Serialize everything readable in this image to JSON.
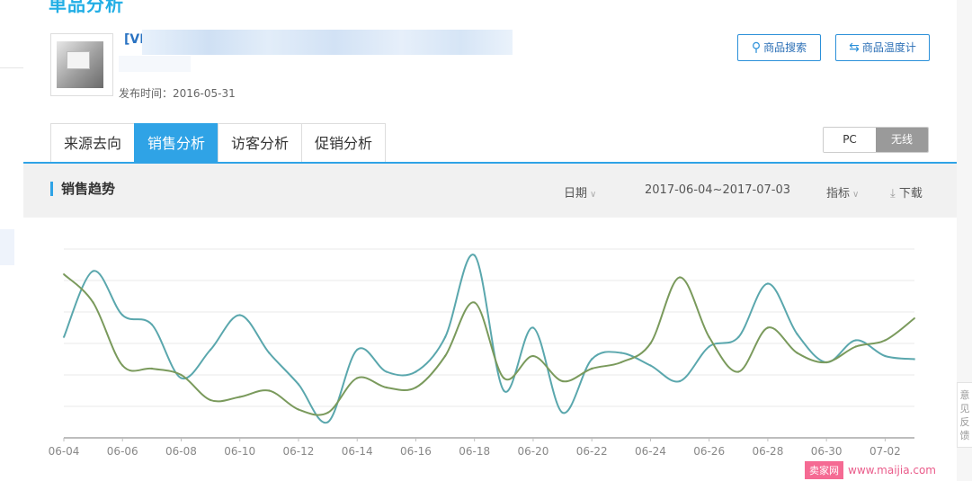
{
  "page": {
    "title": "单品分析"
  },
  "product": {
    "name_visible": "[VH/",
    "publish_date": "发布时间：2016-05-31"
  },
  "header_buttons": {
    "search_label": "商品搜索",
    "temp_label": "商品温度计"
  },
  "tabs": [
    {
      "label": "来源去向",
      "active": false
    },
    {
      "label": "销售分析",
      "active": true
    },
    {
      "label": "访客分析",
      "active": false
    },
    {
      "label": "促销分析",
      "active": false
    }
  ],
  "device_toggle": {
    "pc_label": "PC",
    "wireless_label": "无线",
    "selected": "无线"
  },
  "section": {
    "title": "销售趋势",
    "date_filter_label": "日期",
    "date_range": "2017-06-04~2017-07-03",
    "metric_filter_label": "指标",
    "download_label": "下载"
  },
  "side_float": {
    "text": "意见反馈"
  },
  "watermark": {
    "badge": "卖家网",
    "url": "www.maijia.com"
  },
  "colors": {
    "accent": "#2fa3e6",
    "teal_series": "#5aa7ad",
    "olive_series": "#7a9a5c"
  },
  "chart_data": {
    "type": "line",
    "x": [
      "06-04",
      "06-05",
      "06-06",
      "06-07",
      "06-08",
      "06-09",
      "06-10",
      "06-11",
      "06-12",
      "06-13",
      "06-14",
      "06-15",
      "06-16",
      "06-17",
      "06-18",
      "06-19",
      "06-20",
      "06-21",
      "06-22",
      "06-23",
      "06-24",
      "06-25",
      "06-26",
      "06-27",
      "06-28",
      "06-29",
      "06-30",
      "07-01",
      "07-02",
      "07-03"
    ],
    "tick_labels": [
      "06-04",
      "06-06",
      "06-08",
      "06-10",
      "06-12",
      "06-14",
      "06-16",
      "06-18",
      "06-20",
      "06-22",
      "06-24",
      "06-26",
      "06-28",
      "06-30",
      "07-02"
    ],
    "y_axis_labels_visible": false,
    "ylim": [
      0,
      6
    ],
    "grid": true,
    "series": [
      {
        "color": "#5aa7ad",
        "values": [
          3.2,
          5.3,
          3.9,
          3.6,
          1.9,
          2.8,
          3.9,
          2.7,
          1.7,
          0.5,
          2.8,
          2.1,
          2.1,
          3.2,
          5.8,
          1.5,
          3.5,
          0.8,
          2.5,
          2.7,
          2.3,
          1.8,
          2.9,
          3.2,
          4.9,
          3.3,
          2.4,
          3.1,
          2.6,
          2.5
        ]
      },
      {
        "color": "#7a9a5c",
        "values": [
          5.2,
          4.3,
          2.3,
          2.2,
          2.0,
          1.2,
          1.3,
          1.5,
          0.9,
          0.8,
          1.9,
          1.6,
          1.6,
          2.6,
          4.3,
          1.9,
          2.6,
          1.8,
          2.2,
          2.4,
          3.0,
          5.1,
          3.2,
          2.1,
          3.5,
          2.7,
          2.4,
          2.9,
          3.1,
          3.8
        ]
      }
    ]
  }
}
